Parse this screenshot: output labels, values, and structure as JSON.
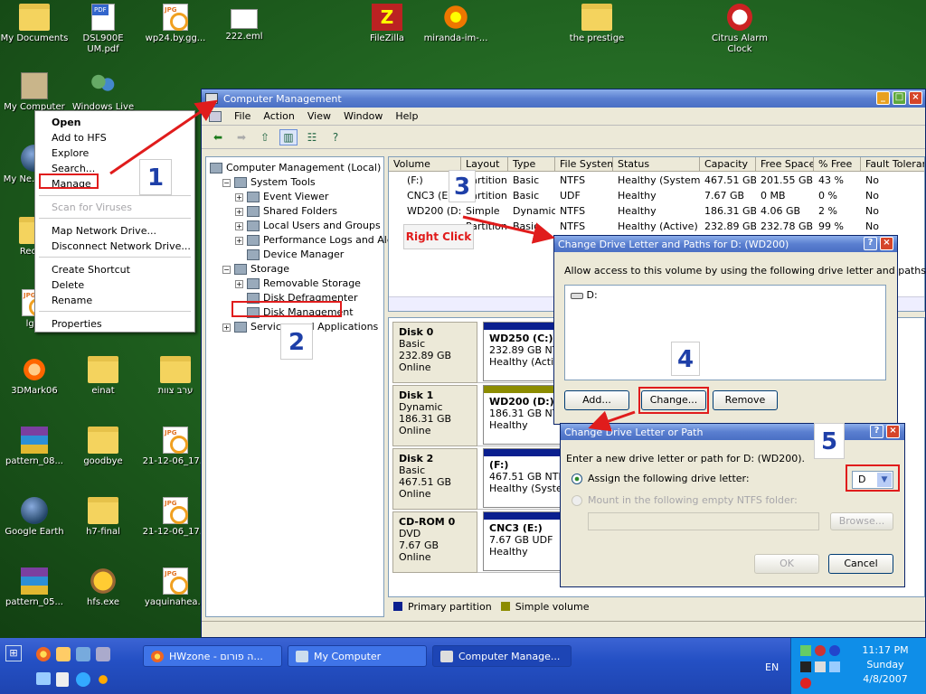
{
  "desktop": {
    "icons": [
      {
        "label": "My Documents",
        "type": "folder"
      },
      {
        "label": "DSL900E UM.pdf",
        "type": "pdf"
      },
      {
        "label": "wp24.by.gg...",
        "type": "jpg"
      },
      {
        "label": "222.eml",
        "type": "mail"
      },
      {
        "label": "FileZilla",
        "type": "fz"
      },
      {
        "label": "miranda-im-...",
        "type": "flower"
      },
      {
        "label": "the prestige",
        "type": "folder"
      },
      {
        "label": "Citrus Alarm Clock",
        "type": "clock"
      },
      {
        "label": "My Computer",
        "type": "pc"
      },
      {
        "label": "Windows Live",
        "type": "users"
      },
      {
        "label": "My Ne... Pla...",
        "type": "globe"
      },
      {
        "label": "Recy...",
        "type": "folder"
      },
      {
        "label": "lg...",
        "type": "jpg"
      },
      {
        "label": "3DMark06",
        "type": "gear"
      },
      {
        "label": "einat",
        "type": "folder"
      },
      {
        "label": "ערב צוות",
        "type": "folder"
      },
      {
        "label": "pattern_08...",
        "type": "zip"
      },
      {
        "label": "goodbye",
        "type": "folder"
      },
      {
        "label": "21-12-06_17...",
        "type": "jpg"
      },
      {
        "label": "Google Earth",
        "type": "globe"
      },
      {
        "label": "h7-final",
        "type": "folder"
      },
      {
        "label": "21-12-06_17...",
        "type": "jpg"
      },
      {
        "label": "pattern_05...",
        "type": "zip"
      },
      {
        "label": "hfs.exe",
        "type": "exe"
      },
      {
        "label": "yaquinahea...",
        "type": "jpg"
      }
    ]
  },
  "context_menu": {
    "items": [
      "Open",
      "Add to HFS",
      "Explore",
      "Search...",
      "Manage",
      "Scan for Viruses",
      "Map Network Drive...",
      "Disconnect Network Drive...",
      "Create Shortcut",
      "Delete",
      "Rename",
      "Properties"
    ]
  },
  "computer_management": {
    "title": "Computer Management",
    "menu": [
      "File",
      "Action",
      "View",
      "Window",
      "Help"
    ],
    "tree": [
      {
        "label": "Computer Management (Local)",
        "level": 0,
        "exp": ""
      },
      {
        "label": "System Tools",
        "level": 1,
        "exp": "−"
      },
      {
        "label": "Event Viewer",
        "level": 2,
        "exp": "+"
      },
      {
        "label": "Shared Folders",
        "level": 2,
        "exp": "+"
      },
      {
        "label": "Local Users and Groups",
        "level": 2,
        "exp": "+"
      },
      {
        "label": "Performance Logs and Alerts",
        "level": 2,
        "exp": "+"
      },
      {
        "label": "Device Manager",
        "level": 2,
        "exp": ""
      },
      {
        "label": "Storage",
        "level": 1,
        "exp": "−"
      },
      {
        "label": "Removable Storage",
        "level": 2,
        "exp": "+"
      },
      {
        "label": "Disk Defragmenter",
        "level": 2,
        "exp": ""
      },
      {
        "label": "Disk Management",
        "level": 2,
        "exp": ""
      },
      {
        "label": "Services and Applications",
        "level": 1,
        "exp": "+"
      }
    ],
    "volume_columns": [
      "Volume",
      "Layout",
      "Type",
      "File System",
      "Status",
      "Capacity",
      "Free Space",
      "% Free",
      "Fault Toleran"
    ],
    "volumes": [
      [
        "(F:)",
        "Partition",
        "Basic",
        "NTFS",
        "Healthy (System)",
        "467.51 GB",
        "201.55 GB",
        "43 %",
        "No"
      ],
      [
        "CNC3 (E:)",
        "Partition",
        "Basic",
        "UDF",
        "Healthy",
        "7.67 GB",
        "0 MB",
        "0 %",
        "No"
      ],
      [
        "WD200 (D:)",
        "Simple",
        "Dynamic",
        "NTFS",
        "Healthy",
        "186.31 GB",
        "4.06 GB",
        "2 %",
        "No"
      ],
      [
        "",
        "Partition",
        "Basic",
        "NTFS",
        "Healthy (Active)",
        "232.89 GB",
        "232.78 GB",
        "99 %",
        "No"
      ]
    ],
    "disks": [
      {
        "name": "Disk 0",
        "kind": "Basic",
        "size": "232.89 GB",
        "state": "Online",
        "part_name": "WD250 (C:)",
        "part_size": "232.89 GB NTFS",
        "part_status": "Healthy (Active)"
      },
      {
        "name": "Disk 1",
        "kind": "Dynamic",
        "size": "186.31 GB",
        "state": "Online",
        "part_name": "WD200 (D:)",
        "part_size": "186.31 GB NTFS",
        "part_status": "Healthy"
      },
      {
        "name": "Disk 2",
        "kind": "Basic",
        "size": "467.51 GB",
        "state": "Online",
        "part_name": "(F:)",
        "part_size": "467.51 GB NTFS",
        "part_status": "Healthy (System)"
      },
      {
        "name": "CD-ROM 0",
        "kind": "DVD",
        "size": "7.67 GB",
        "state": "Online",
        "part_name": "CNC3 (E:)",
        "part_size": "7.67 GB UDF",
        "part_status": "Healthy"
      }
    ],
    "legend": {
      "primary": "Primary partition",
      "simple": "Simple volume"
    }
  },
  "dialog_paths": {
    "title": "Change Drive Letter and Paths for D: (WD200)",
    "prompt": "Allow access to this volume by using the following drive letter and paths:",
    "entry": "D:",
    "add": "Add...",
    "change": "Change...",
    "remove": "Remove"
  },
  "dialog_change": {
    "title": "Change Drive Letter or Path",
    "prompt": "Enter a new drive letter or path for D: (WD200).",
    "opt_assign": "Assign the following drive letter:",
    "opt_mount": "Mount in the following empty NTFS folder:",
    "letter": "D",
    "browse": "Browse...",
    "ok": "OK",
    "cancel": "Cancel"
  },
  "annotations": {
    "step1": "1",
    "step2": "2",
    "step3": "3",
    "step4": "4",
    "step5": "5",
    "right_click": "Right Click"
  },
  "taskbar": {
    "tasks": [
      "HWzone - ה פורום...",
      "My Computer",
      "Computer Manage..."
    ],
    "lang": "EN",
    "time": "11:17 PM",
    "day": "Sunday",
    "date": "4/8/2007"
  }
}
